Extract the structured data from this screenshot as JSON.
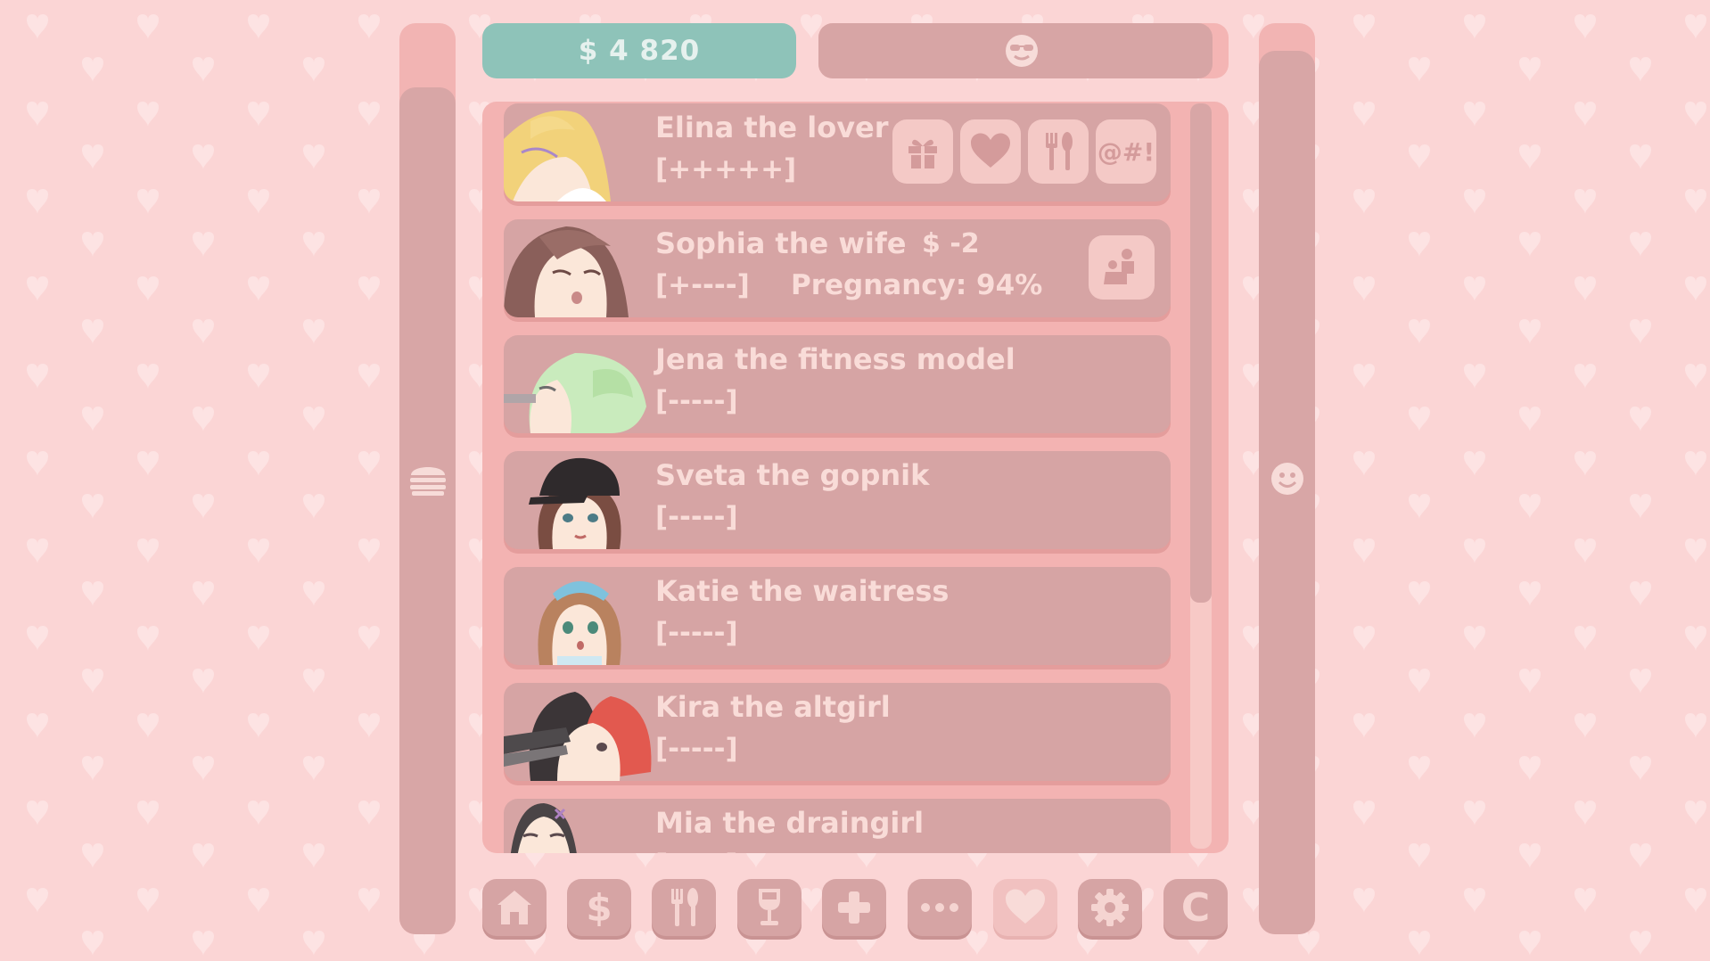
{
  "money": {
    "label": "$ 4 820"
  },
  "mood": {
    "level": 0.96,
    "icon": "sunglasses-face-icon"
  },
  "side_left": {
    "icon": "burger-icon",
    "level": 0.93
  },
  "side_right": {
    "icon": "smile-face-icon",
    "level": 0.97
  },
  "girls": [
    {
      "name": "Elina the lover",
      "stat": "[+++++]",
      "actions": [
        {
          "icon": "gift-icon"
        },
        {
          "icon": "heart-icon"
        },
        {
          "icon": "fork-spoon-icon"
        },
        {
          "icon": "swear-icon",
          "label": "@#!"
        }
      ]
    },
    {
      "name": "Sophia the wife",
      "money": "$ -2",
      "stat": "[+----]",
      "pregnancy": "Pregnancy: 94%",
      "actions": [
        {
          "icon": "couple-icon"
        }
      ]
    },
    {
      "name": "Jena the fitness model",
      "stat": "[-----]"
    },
    {
      "name": "Sveta the gopnik",
      "stat": "[-----]"
    },
    {
      "name": "Katie the waitress",
      "stat": "[-----]"
    },
    {
      "name": "Kira the altgirl",
      "stat": "[-----]"
    },
    {
      "name": "Mia the draingirl",
      "stat": "[-----]"
    }
  ],
  "nav": [
    {
      "icon": "home-icon"
    },
    {
      "icon": "dollar-icon",
      "label": "$"
    },
    {
      "icon": "fork-spoon-icon"
    },
    {
      "icon": "wine-glass-icon"
    },
    {
      "icon": "plus-icon"
    },
    {
      "icon": "more-dots-icon"
    },
    {
      "icon": "heart-icon",
      "active": true
    },
    {
      "icon": "gear-icon"
    },
    {
      "icon": "c-icon",
      "label": "C"
    }
  ],
  "colors": {
    "background": "#fbd5d5",
    "panel": "#f3b3b2",
    "card": "#d6a4a4",
    "money_bar": "#8ec3b9",
    "text_light": "#f9dcd8"
  }
}
